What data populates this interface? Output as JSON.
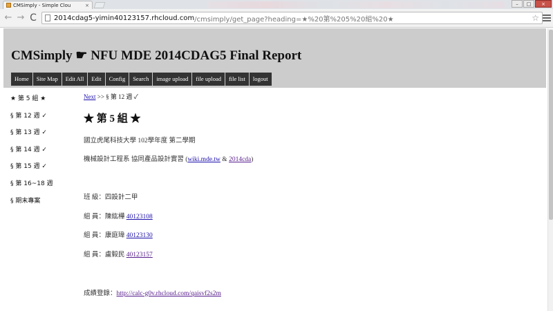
{
  "browser": {
    "tab_title": "CMSimply - Simple Clou",
    "tab_close": "×",
    "url_host": "2014cdag5-yimin40123157.rhcloud.com",
    "url_path": "/cmsimply/get_page?heading=★%20第%205%20組%20★",
    "nav": {
      "back": "←",
      "forward": "→",
      "reload": "C"
    },
    "star": "☆",
    "win": {
      "minimize": "–",
      "maximize": "□",
      "close": "×"
    }
  },
  "site": {
    "title": "CMSimply ☛ NFU MDE 2014CDAG5 Final Report",
    "menu": [
      "Home",
      "Site Map",
      "Edit All",
      "Edit",
      "Config",
      "Search",
      "image upload",
      "file upload",
      "file list",
      "logout"
    ]
  },
  "sidebar": {
    "items": [
      "★ 第 5 組 ★",
      "§ 第 12 週 ✓",
      "§ 第 13 週 ✓",
      "§ 第 14 週 ✓",
      "§ 第 15 週 ✓",
      "§ 第 16~18 週",
      "§ 期末專案"
    ]
  },
  "content": {
    "breadcrumb": {
      "next_link": "Next",
      "separator": " >> ",
      "current": "§ 第 12 週 ✓"
    },
    "heading": "★ 第 5 組 ★",
    "school_line": "國立虎尾科技大學  102學年度  第二學期",
    "dept_prefix": "機械設計工程系   協同產品設計實習 (",
    "dept_link1": "wiki.mde.tw",
    "dept_amp": " & ",
    "dept_link2": "2014cda",
    "dept_suffix": ")",
    "class_line": "班  級：四設計二甲",
    "members": [
      {
        "label": "組  員：陳紘樺 ",
        "id": "40123108"
      },
      {
        "label": "組  員：康庭瑋 ",
        "id": "40123130"
      },
      {
        "label": "組  員：盧毅民 ",
        "id": "40123157"
      }
    ],
    "grade_label": "成績登錄：",
    "grade_link": "http://calc-g0v.rhcloud.com/qaisvf2s2m"
  }
}
